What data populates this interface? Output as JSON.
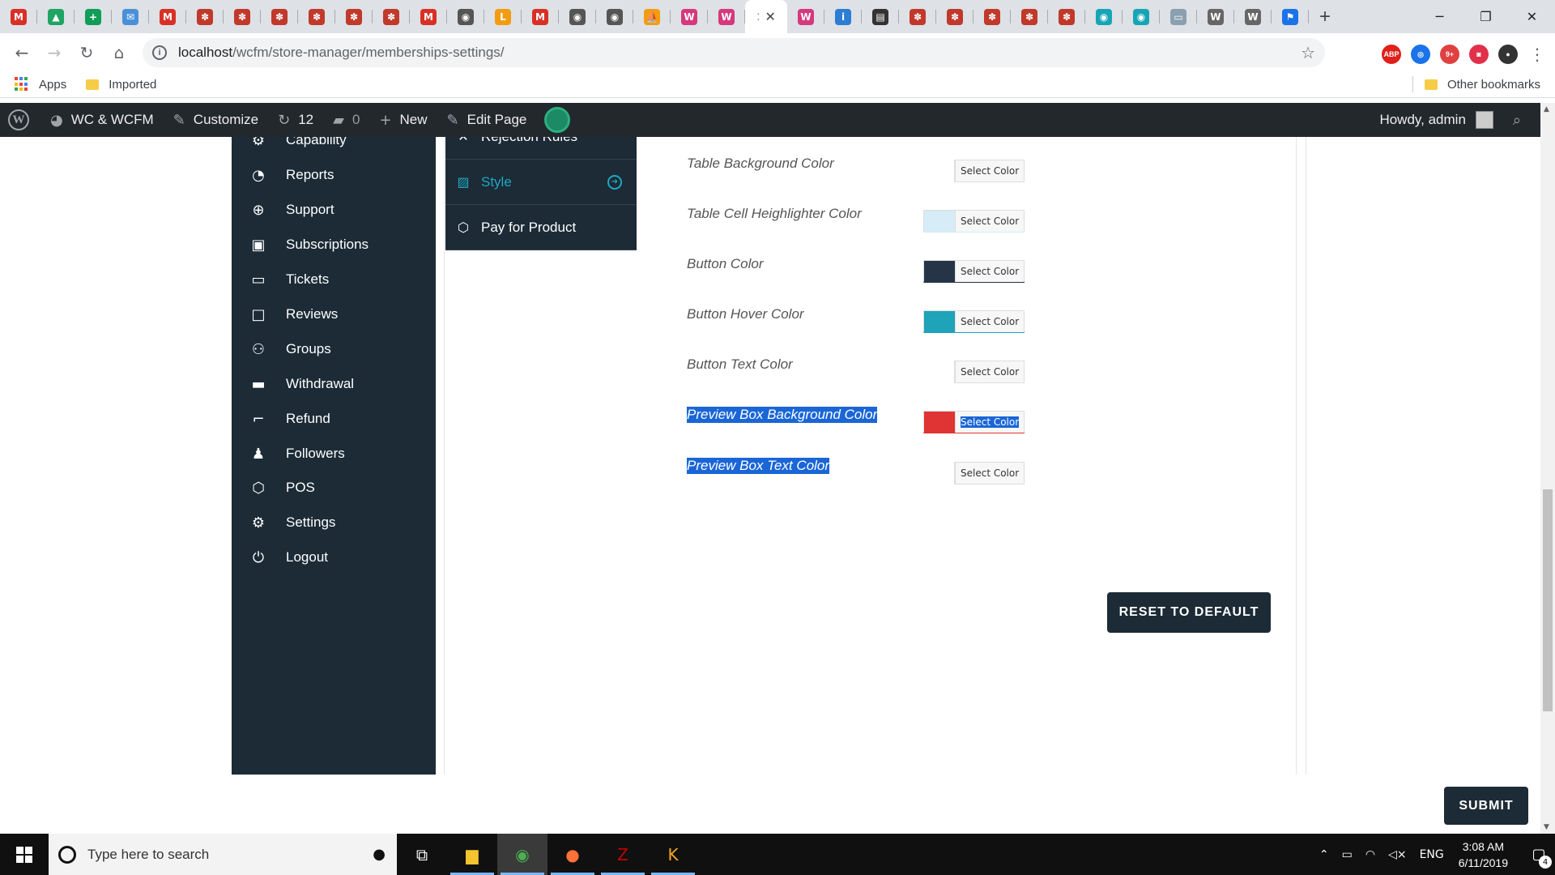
{
  "browser": {
    "tabs": [
      {
        "icon": "gmail-icon",
        "glyph": "M",
        "color": "#d93025"
      },
      {
        "icon": "drive-icon",
        "glyph": "▲",
        "color": "#1fa463"
      },
      {
        "icon": "sheets-icon",
        "glyph": "+",
        "color": "#0f9d58"
      },
      {
        "icon": "mail-icon",
        "glyph": "✉",
        "color": "#4a90d9"
      },
      {
        "icon": "gmail-icon",
        "glyph": "M",
        "color": "#d93025"
      },
      {
        "icon": "site-icon",
        "glyph": "✽",
        "color": "#c0392b"
      },
      {
        "icon": "site-icon",
        "glyph": "✽",
        "color": "#c0392b"
      },
      {
        "icon": "site-icon",
        "glyph": "✽",
        "color": "#c0392b"
      },
      {
        "icon": "site-icon",
        "glyph": "✽",
        "color": "#c0392b"
      },
      {
        "icon": "site-icon",
        "glyph": "✽",
        "color": "#c0392b"
      },
      {
        "icon": "site-icon",
        "glyph": "✽",
        "color": "#c0392b"
      },
      {
        "icon": "gmail-icon",
        "glyph": "M",
        "color": "#d93025"
      },
      {
        "icon": "globe-icon",
        "glyph": "◉",
        "color": "#555555"
      },
      {
        "icon": "orange-doc-icon",
        "glyph": "L",
        "color": "#f39c12"
      },
      {
        "icon": "gmail-icon",
        "glyph": "M",
        "color": "#d93025"
      },
      {
        "icon": "globe-icon",
        "glyph": "◉",
        "color": "#555555"
      },
      {
        "icon": "globe-icon",
        "glyph": "◉",
        "color": "#555555"
      },
      {
        "icon": "pma-icon",
        "glyph": "⛵",
        "color": "#f39c12"
      },
      {
        "icon": "woo-icon",
        "glyph": "W",
        "color": "#d6387d"
      },
      {
        "icon": "woo-icon",
        "glyph": "W",
        "color": "#d6387d"
      }
    ],
    "tabs_after_active": [
      {
        "icon": "woo-icon",
        "glyph": "W",
        "color": "#d6387d"
      },
      {
        "icon": "ibb-icon",
        "glyph": "i",
        "color": "#2d7dd2"
      },
      {
        "icon": "film-icon",
        "glyph": "▤",
        "color": "#333333"
      },
      {
        "icon": "site-icon",
        "glyph": "✽",
        "color": "#c0392b"
      },
      {
        "icon": "site-icon",
        "glyph": "✽",
        "color": "#c0392b"
      },
      {
        "icon": "site-icon",
        "glyph": "✽",
        "color": "#c0392b"
      },
      {
        "icon": "site-icon",
        "glyph": "✽",
        "color": "#c0392b"
      },
      {
        "icon": "site-icon",
        "glyph": "✽",
        "color": "#c0392b"
      },
      {
        "icon": "teal-globe-icon",
        "glyph": "◉",
        "color": "#16a5b5"
      },
      {
        "icon": "teal-globe-icon",
        "glyph": "◉",
        "color": "#16a5b5"
      },
      {
        "icon": "screen-icon",
        "glyph": "▭",
        "color": "#8aa0b0"
      },
      {
        "icon": "wordpress-icon",
        "glyph": "W",
        "color": "#666666"
      },
      {
        "icon": "wordpress-icon",
        "glyph": "W",
        "color": "#666666"
      },
      {
        "icon": "flag-icon",
        "glyph": "⚑",
        "color": "#1a73e8"
      }
    ],
    "active_tab_glyph": ":",
    "active_tab_close": "✕",
    "new_tab": "+",
    "window_controls": {
      "minimize": "─",
      "restore": "❐",
      "close": "✕"
    },
    "nav": {
      "back": "←",
      "forward": "→",
      "reload": "↻",
      "home": "⌂"
    },
    "url_host": "localhost",
    "url_path": "/wcfm/store-manager/memberships-settings/",
    "info": "i",
    "star": "☆",
    "extensions": [
      {
        "icon": "abp-icon",
        "label": "ABP",
        "color": "#e0201a"
      },
      {
        "icon": "camera-ext-icon",
        "label": "◎",
        "color": "#1a73e8"
      },
      {
        "icon": "globe-ext-icon",
        "label": "9+",
        "color": "#e04040"
      },
      {
        "icon": "pocket-icon",
        "label": "◙",
        "color": "#e0304a"
      },
      {
        "icon": "profile-icon",
        "label": "●",
        "color": "#333333"
      }
    ],
    "menu": "⋮",
    "bookmarks": {
      "apps": "Apps",
      "imported": "Imported",
      "other": "Other bookmarks"
    },
    "apps_colors": [
      "#ea4335",
      "#4285f4",
      "#34a853",
      "#fbbc05",
      "#ea4335",
      "#4285f4",
      "#34a853",
      "#fbbc05",
      "#ea4335"
    ]
  },
  "adminbar": {
    "site": "WC & WCFM",
    "customize": "Customize",
    "updates": "12",
    "comments": "0",
    "new": "New",
    "edit_page": "Edit Page",
    "howdy": "Howdy, admin"
  },
  "sidebar": {
    "items": [
      {
        "label": "Capability",
        "icon": "user-gear-icon",
        "glyph": "⚙"
      },
      {
        "label": "Reports",
        "icon": "pie-chart-icon",
        "glyph": "◔"
      },
      {
        "label": "Support",
        "icon": "lifebuoy-icon",
        "glyph": "⊕"
      },
      {
        "label": "Subscriptions",
        "icon": "money-icon",
        "glyph": "▣"
      },
      {
        "label": "Tickets",
        "icon": "ticket-icon",
        "glyph": "▭"
      },
      {
        "label": "Reviews",
        "icon": "comment-icon",
        "glyph": "□"
      },
      {
        "label": "Groups",
        "icon": "users-icon",
        "glyph": "⚇"
      },
      {
        "label": "Withdrawal",
        "icon": "credit-card-icon",
        "glyph": "▬"
      },
      {
        "label": "Refund",
        "icon": "crop-icon",
        "glyph": "⌐"
      },
      {
        "label": "Followers",
        "icon": "child-icon",
        "glyph": "♟"
      },
      {
        "label": "POS",
        "icon": "cube-icon",
        "glyph": "⬡"
      },
      {
        "label": "Settings",
        "icon": "cogs-icon",
        "glyph": "⚙"
      },
      {
        "label": "Logout",
        "icon": "power-icon",
        "glyph": "⏻"
      }
    ]
  },
  "submenu": {
    "items": [
      {
        "label": "Rejection Rules",
        "icon": "close-icon",
        "glyph": "✕",
        "active": false
      },
      {
        "label": "Style",
        "icon": "image-icon",
        "glyph": "▨",
        "active": true
      },
      {
        "label": "Pay for Product",
        "icon": "box-icon",
        "glyph": "⬡",
        "active": false
      }
    ],
    "active_arrow": "➜"
  },
  "style_settings": {
    "select_color_label": "Select Color",
    "rows": [
      {
        "label": "Table Background Color",
        "swatch": null,
        "selected": false
      },
      {
        "label": "Table Cell Heighlighter Color",
        "swatch": "#d6ecf6",
        "selected": false
      },
      {
        "label": "Button Color",
        "swatch": "#253447",
        "selected": false
      },
      {
        "label": "Button Hover Color",
        "swatch": "#1ea3b8",
        "selected": false
      },
      {
        "label": "Button Text Color",
        "swatch": null,
        "selected": false
      },
      {
        "label": "Preview Box Background Color",
        "swatch": "#e03333",
        "selected": true
      },
      {
        "label": "Preview Box Text Color",
        "swatch": null,
        "selected": true
      }
    ],
    "reset_label": "RESET TO DEFAULT"
  },
  "submit_label": "SUBMIT",
  "taskbar": {
    "search_placeholder": "Type here to search",
    "mic": "🎤",
    "apps": [
      {
        "icon": "task-view-icon",
        "glyph": "⧉",
        "color": "#ffffff",
        "active": false
      },
      {
        "icon": "file-explorer-icon",
        "glyph": "▆",
        "color": "#f4c430",
        "active": false
      },
      {
        "icon": "chrome-icon",
        "glyph": "◉",
        "color": "#4caf50",
        "active": true
      },
      {
        "icon": "firefox-icon",
        "glyph": "●",
        "color": "#ff7139",
        "active": false
      },
      {
        "icon": "filezilla-icon",
        "glyph": "Z",
        "color": "#bf0000",
        "active": false
      },
      {
        "icon": "jetbrains-icon",
        "glyph": "K",
        "color": "#f5a623",
        "active": false
      }
    ],
    "tray": {
      "chevron": "⌃",
      "battery": "▭",
      "wifi": "◠",
      "volume": "◁×",
      "lang": "ENG"
    },
    "time": "3:08 AM",
    "date": "6/11/2019",
    "notification_count": "4",
    "notif_glyph": "▢"
  }
}
